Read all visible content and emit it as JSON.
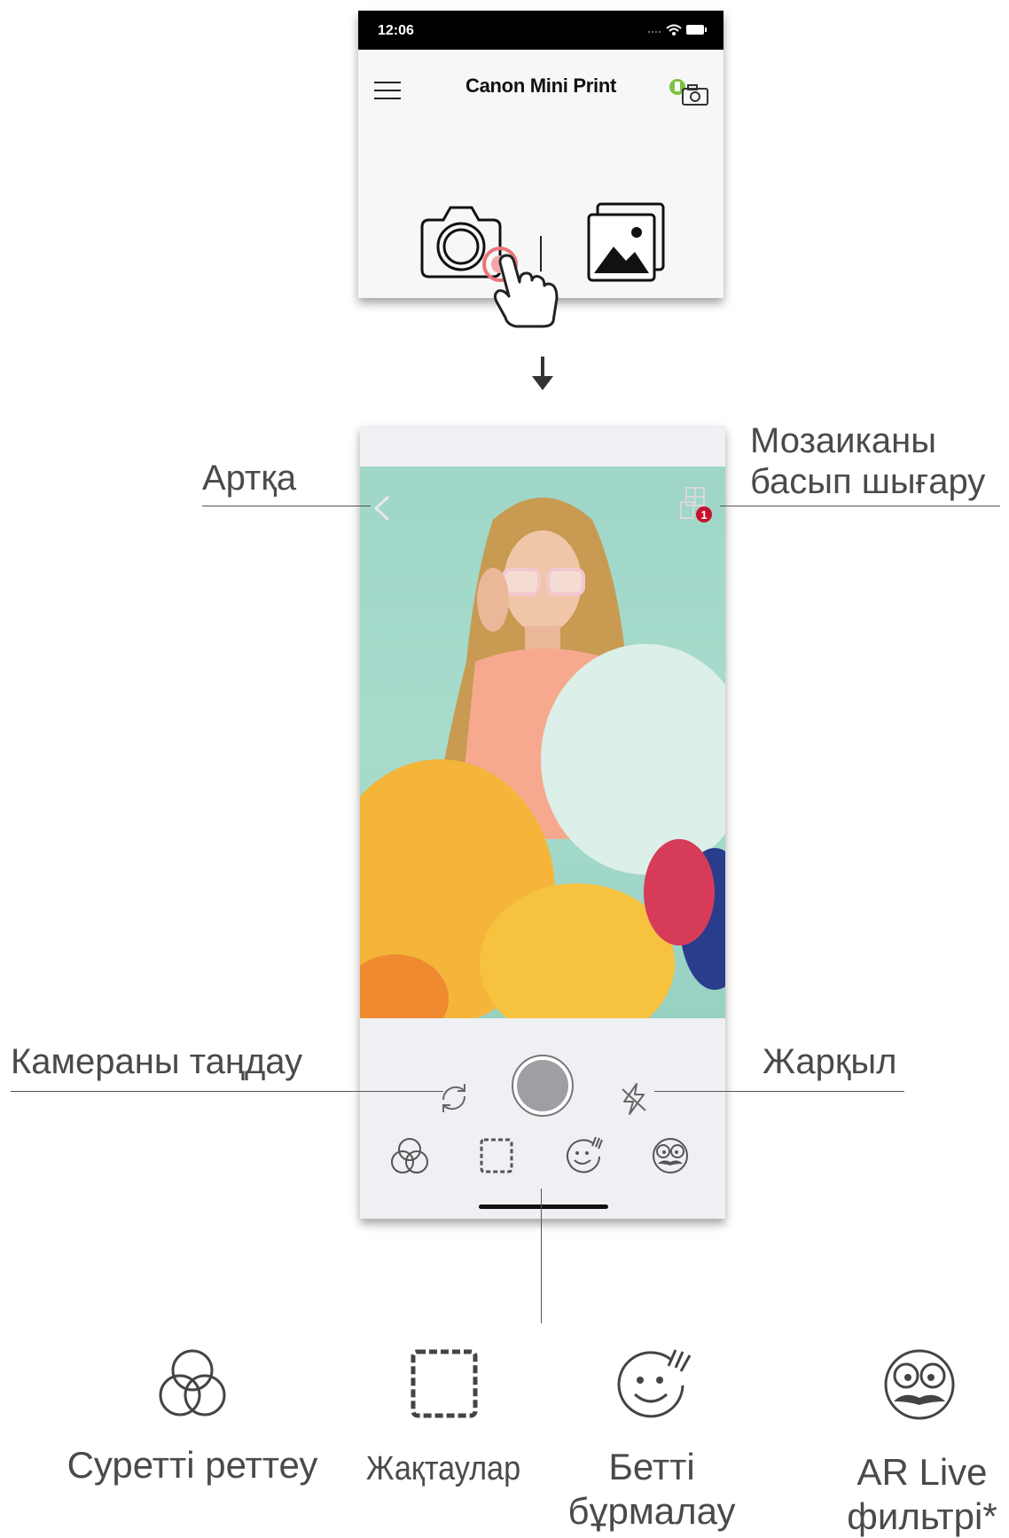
{
  "top_screen": {
    "status_bar": {
      "time": "12:06",
      "signal_icon": "signal-dots-icon",
      "wifi_icon": "wifi-icon",
      "battery_icon": "battery-icon"
    },
    "header": {
      "title": "Canon Mini Print",
      "menu_icon": "hamburger-menu-icon",
      "printer_icon": "printer-status-icon"
    },
    "actions": [
      {
        "name": "camera",
        "icon": "camera-icon"
      },
      {
        "name": "gallery",
        "icon": "gallery-icon"
      }
    ],
    "tap_indicator": "hand-pointer-icon",
    "accent_color": "#e8747c"
  },
  "camera_screen": {
    "back_icon": "back-chevron-icon",
    "collage_icon": "collage-print-icon",
    "collage_badge": "1",
    "shutter_icon": "shutter-button",
    "switch_icon": "switch-camera-icon",
    "flash_icon": "flash-off-icon",
    "tools": [
      {
        "icon": "adjust-circles-icon"
      },
      {
        "icon": "frames-icon"
      },
      {
        "icon": "face-distortion-icon"
      },
      {
        "icon": "ar-mask-icon"
      }
    ],
    "badge_color": "#c8102e"
  },
  "callouts": {
    "back": "Артқа",
    "collage_line1": "Мозаиканы",
    "collage_line2": "басып шығару",
    "switch_camera": "Камераны таңдау",
    "flash": "Жарқыл"
  },
  "legend": {
    "adjust": "Суретті реттеу",
    "frames": "Жақтаулар",
    "face_line1": "Бетті",
    "face_line2": "бұрмалау",
    "ar_line1": "AR Live",
    "ar_line2": "фильтрі*"
  }
}
